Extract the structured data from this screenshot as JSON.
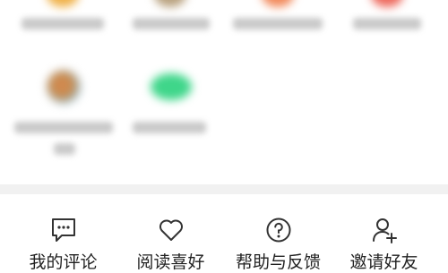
{
  "apps_grid": {
    "row1": [
      {
        "icon_name": "blurred-app-icon",
        "color": "#f0b24a"
      },
      {
        "icon_name": "blurred-app-icon",
        "color": "#b9a27f"
      },
      {
        "icon_name": "blurred-app-icon",
        "color": "#f28a5c"
      },
      {
        "icon_name": "blurred-app-icon",
        "color": "#ee6a5e"
      }
    ],
    "row2": [
      {
        "icon_name": "blurred-app-icon",
        "color": "#d68a55"
      },
      {
        "icon_name": "blurred-app-icon",
        "color": "#3fd68a"
      }
    ]
  },
  "bottom_actions": [
    {
      "label": "我的评论",
      "icon": "comment-icon"
    },
    {
      "label": "阅读喜好",
      "icon": "heart-icon"
    },
    {
      "label": "帮助与反馈",
      "icon": "help-icon"
    },
    {
      "label": "邀请好友",
      "icon": "add-user-icon"
    }
  ],
  "colors": {
    "icon_stroke": "#333333",
    "label_text": "#222222",
    "separator": "#f1f1f1"
  }
}
